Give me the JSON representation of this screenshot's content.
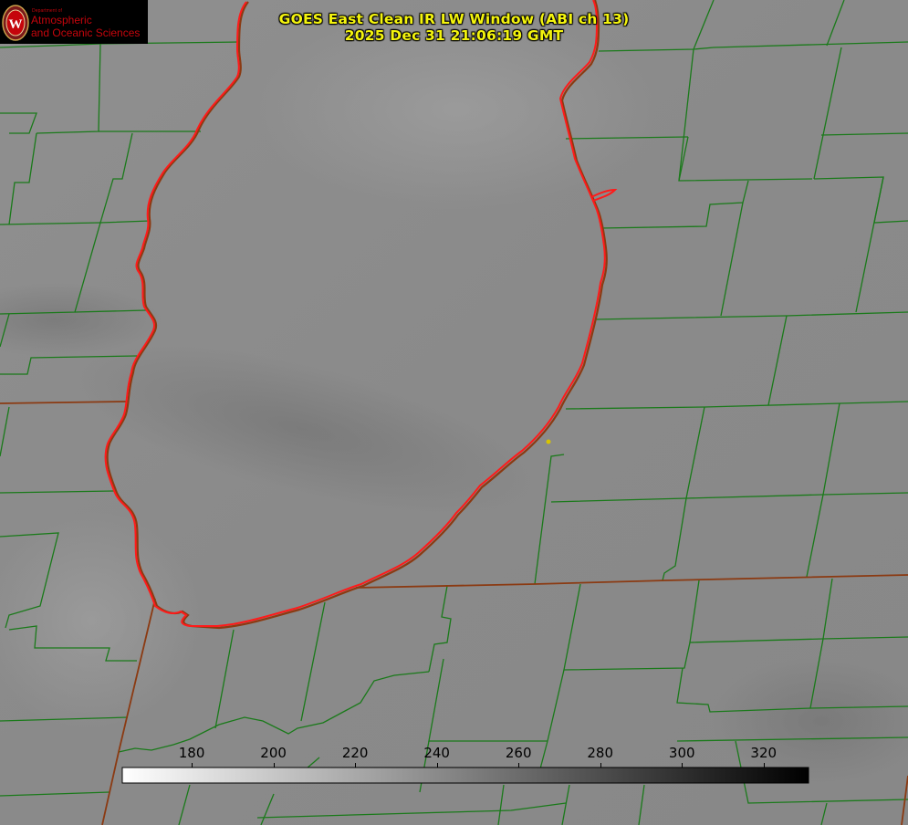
{
  "title": {
    "line1": "GOES East Clean IR LW Window (ABI ch 13)",
    "line2": "2025 Dec 31 21:06:19 GMT"
  },
  "logo": {
    "department": "Department of",
    "line1": "Atmospheric",
    "line2": "and Oceanic Sciences",
    "seal_letter": "W",
    "color": "#c5050c"
  },
  "colorbar": {
    "ticks": [
      "180",
      "200",
      "220",
      "240",
      "260",
      "280",
      "300",
      "320"
    ],
    "tick_values": [
      180,
      200,
      220,
      240,
      260,
      280,
      300,
      320
    ],
    "range": [
      163,
      331
    ],
    "gradient": "white-to-black"
  },
  "colors": {
    "background_gray": "#8d8d8d",
    "county_lines": "#1a7a1a",
    "state_lines": "#8b3a12",
    "lake_outline": "#ff1a1a",
    "title_text": "#f4f40e",
    "marker": "#d8c400"
  }
}
